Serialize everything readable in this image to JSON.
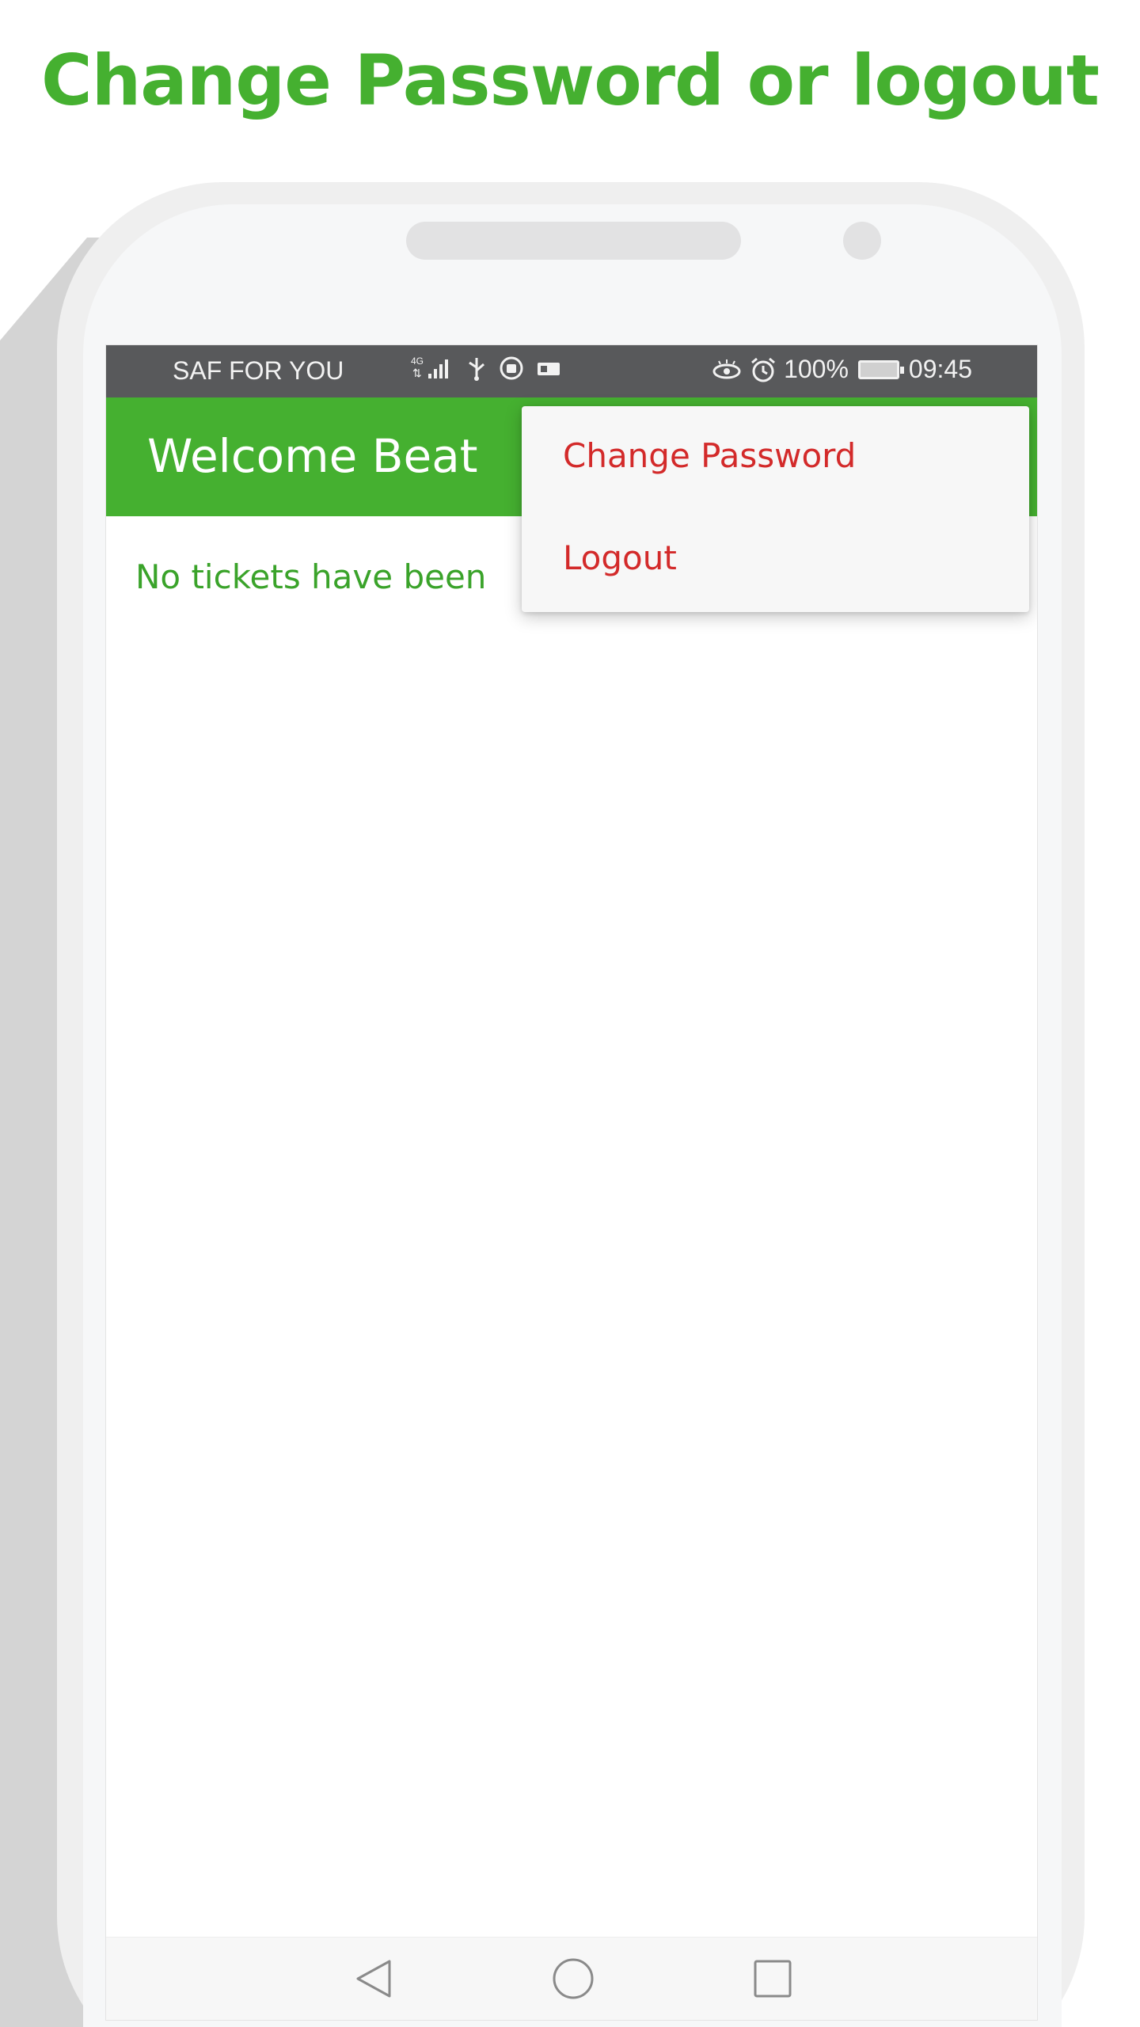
{
  "headline": "Change Password or logout",
  "colors": {
    "accent_green": "#45b030",
    "menu_red": "#d32a2a",
    "status_bar": "#58595b"
  },
  "status_bar": {
    "carrier": "SAF FOR YOU",
    "left_icons": [
      "signal-4g-icon",
      "usb-icon",
      "vpn-icon",
      "sim-icon"
    ],
    "right_icons": [
      "eye-comfort-icon",
      "alarm-icon",
      "battery-icon"
    ],
    "battery": "100%",
    "time": "09:45"
  },
  "app_bar": {
    "title": "Welcome Beat"
  },
  "content": {
    "empty_message": "No tickets have been"
  },
  "menu": {
    "items": [
      {
        "label": "Change Password"
      },
      {
        "label": "Logout"
      }
    ]
  },
  "nav_bar": {
    "icons": [
      "back-icon",
      "home-icon",
      "recents-icon"
    ]
  }
}
